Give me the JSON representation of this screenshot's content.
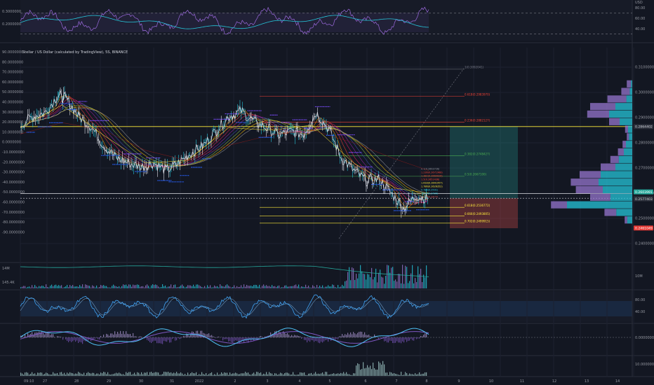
{
  "chart_data": [
    {
      "type": "line",
      "panel": "rsi",
      "y_unit_label": "USD",
      "y_ticks": [
        "80.00",
        "60.00",
        "40.00"
      ],
      "left_labels": [
        "0.3000000",
        "0.2000000"
      ],
      "levels": [
        70,
        30
      ],
      "ylim": [
        20,
        90
      ]
    },
    {
      "type": "line",
      "title": "Stellar / US Dollar (calculated by TradingView), 5S, BINANCE",
      "price_ticks": [
        "0.3100000",
        "0.3000000",
        "0.2900000",
        "0.2800000",
        "0.2700000",
        "0.2600000",
        "0.2500000",
        "0.2400000"
      ],
      "price_range": [
        0.2395,
        0.3105
      ],
      "left_ticks": [
        "90.0000000",
        "80.0000000",
        "70.0000000",
        "60.0000000",
        "50.0000000",
        "40.0000000",
        "30.0000000",
        "20.0000000",
        "10.0000000",
        "0.0000000",
        "-10.0000000",
        "-20.0000000",
        "-30.0000000",
        "-40.0000000",
        "-50.0000000",
        "-60.0000000",
        "-70.0000000",
        "-80.0000000",
        "-90.0000000"
      ],
      "price_badges": [
        {
          "text": "0.2864402",
          "bg": "#2a2e39",
          "fg": "#d1d4dc",
          "value": 0.28644
        },
        {
          "text": "0.2603991",
          "bg": "#26a69a",
          "fg": "#ffffff",
          "value": 0.26052
        },
        {
          "text": "0.2580484",
          "bg": "#1e222d",
          "fg": "#d1d4dc",
          "value": 0.25805
        },
        {
          "text": "0.2577403",
          "bg": "#2a2e39",
          "fg": "#d1d4dc",
          "value": 0.25775
        },
        {
          "text": "0.2461049",
          "bg": "#e53935",
          "fg": "#ffffff",
          "value": 0.24618
        }
      ],
      "fib_levels": [
        {
          "text": "1(0.3092041)",
          "value": 0.3092,
          "color": "#787b86"
        },
        {
          "text": "0.618(0.2983970)",
          "value": 0.2984,
          "color": "#f44336"
        },
        {
          "text": "0.236(0.2882127)",
          "value": 0.2882,
          "color": "#f44336"
        },
        {
          "text": "0.382(0.2748427)",
          "value": 0.2748,
          "color": "#4caf50"
        },
        {
          "text": "0.5(0.2667100)",
          "value": 0.2667,
          "color": "#4caf50"
        },
        {
          "text": "0.618(0.2536772)",
          "value": 0.2544,
          "color": "#ffeb3b"
        },
        {
          "text": "0.666(0.2493805)",
          "value": 0.251,
          "color": "#ffeb3b"
        },
        {
          "text": "0.702(0.2499915)",
          "value": 0.2481,
          "color": "#ffeb3b"
        }
      ],
      "inner_fib_labels": [
        "0.1(0.2693726)",
        "1.236(0.2671968)",
        "1.382(0.2660926)",
        "1.5(0.2651436)",
        "1.618(0.2641957)",
        "1.786(0.2626352)",
        "0.786(0.2501)",
        "1.618(0.2499)",
        "1.618(0.2477)"
      ],
      "series": [
        {
          "name": "price",
          "x": [
            0,
            3,
            6,
            9,
            11,
            14,
            17,
            20,
            23,
            26,
            29,
            32,
            35,
            38,
            41,
            44,
            47,
            50,
            53,
            56,
            59,
            62,
            65,
            68,
            71,
            74,
            77,
            80,
            83,
            86,
            89,
            92,
            95,
            98
          ],
          "values": [
            0.287,
            0.2905,
            0.292,
            0.299,
            0.2975,
            0.2905,
            0.2865,
            0.279,
            0.274,
            0.272,
            0.2705,
            0.272,
            0.269,
            0.272,
            0.276,
            0.279,
            0.285,
            0.2905,
            0.2925,
            0.2885,
            0.286,
            0.283,
            0.2845,
            0.2835,
            0.292,
            0.2855,
            0.274,
            0.269,
            0.265,
            0.2655,
            0.26,
            0.254,
            0.259,
            0.2575
          ]
        },
        {
          "name": "ema-fast",
          "x": [
            0,
            10,
            20,
            30,
            40,
            50,
            60,
            70,
            80,
            90,
            98
          ],
          "values": [
            0.286,
            0.295,
            0.283,
            0.272,
            0.273,
            0.286,
            0.285,
            0.287,
            0.272,
            0.262,
            0.26
          ]
        },
        {
          "name": "ema-slow",
          "x": [
            0,
            10,
            20,
            30,
            40,
            50,
            60,
            70,
            80,
            90,
            98
          ],
          "values": [
            0.2835,
            0.288,
            0.285,
            0.277,
            0.273,
            0.279,
            0.283,
            0.285,
            0.28,
            0.2735,
            0.269
          ]
        }
      ],
      "volume_profile": [
        {
          "value": 0.3033,
          "buy": 3,
          "sell": 10
        },
        {
          "value": 0.3003,
          "buy": 6,
          "sell": 20
        },
        {
          "value": 0.2973,
          "buy": 14,
          "sell": 45
        },
        {
          "value": 0.2943,
          "buy": 40,
          "sell": 60
        },
        {
          "value": 0.2913,
          "buy": 55,
          "sell": 52
        },
        {
          "value": 0.2883,
          "buy": 30,
          "sell": 25
        },
        {
          "value": 0.2853,
          "buy": 10,
          "sell": 7
        },
        {
          "value": 0.2823,
          "buy": 8,
          "sell": 5
        },
        {
          "value": 0.2793,
          "buy": 15,
          "sell": 8
        },
        {
          "value": 0.2763,
          "buy": 20,
          "sell": 14
        },
        {
          "value": 0.2733,
          "buy": 32,
          "sell": 20
        },
        {
          "value": 0.2703,
          "buy": 40,
          "sell": 35
        },
        {
          "value": 0.2673,
          "buy": 75,
          "sell": 50
        },
        {
          "value": 0.2643,
          "buy": 80,
          "sell": 66
        },
        {
          "value": 0.2613,
          "buy": 70,
          "sell": 64
        },
        {
          "value": 0.2583,
          "buy": 52,
          "sell": 48
        },
        {
          "value": 0.2553,
          "buy": 155,
          "sell": 38
        },
        {
          "value": 0.2523,
          "buy": 38,
          "sell": 28
        },
        {
          "value": 0.2493,
          "buy": 12,
          "sell": 6
        }
      ],
      "position_zone": {
        "entry": 0.258,
        "target": 0.2866,
        "stop": 0.2461
      }
    },
    {
      "type": "bar",
      "panel": "volume",
      "labels": [
        "14M",
        "145.4K",
        "10M"
      ]
    },
    {
      "type": "line",
      "panel": "stochastic",
      "y_ticks": [
        "80.00",
        "40.00"
      ],
      "levels": [
        80,
        20
      ]
    },
    {
      "type": "line",
      "panel": "macd",
      "y_ticks": [
        "0.0000000"
      ]
    },
    {
      "type": "bar",
      "panel": "histogram",
      "y_ticks": [
        "10.0000000"
      ]
    }
  ],
  "x_axis": {
    "labels": [
      "09:10",
      "27",
      "28",
      "29",
      "30",
      "31",
      "2022",
      "2",
      "3",
      "4",
      "5",
      "6",
      "7",
      "8",
      "9",
      "10",
      "11",
      "12",
      "13",
      "14"
    ]
  }
}
